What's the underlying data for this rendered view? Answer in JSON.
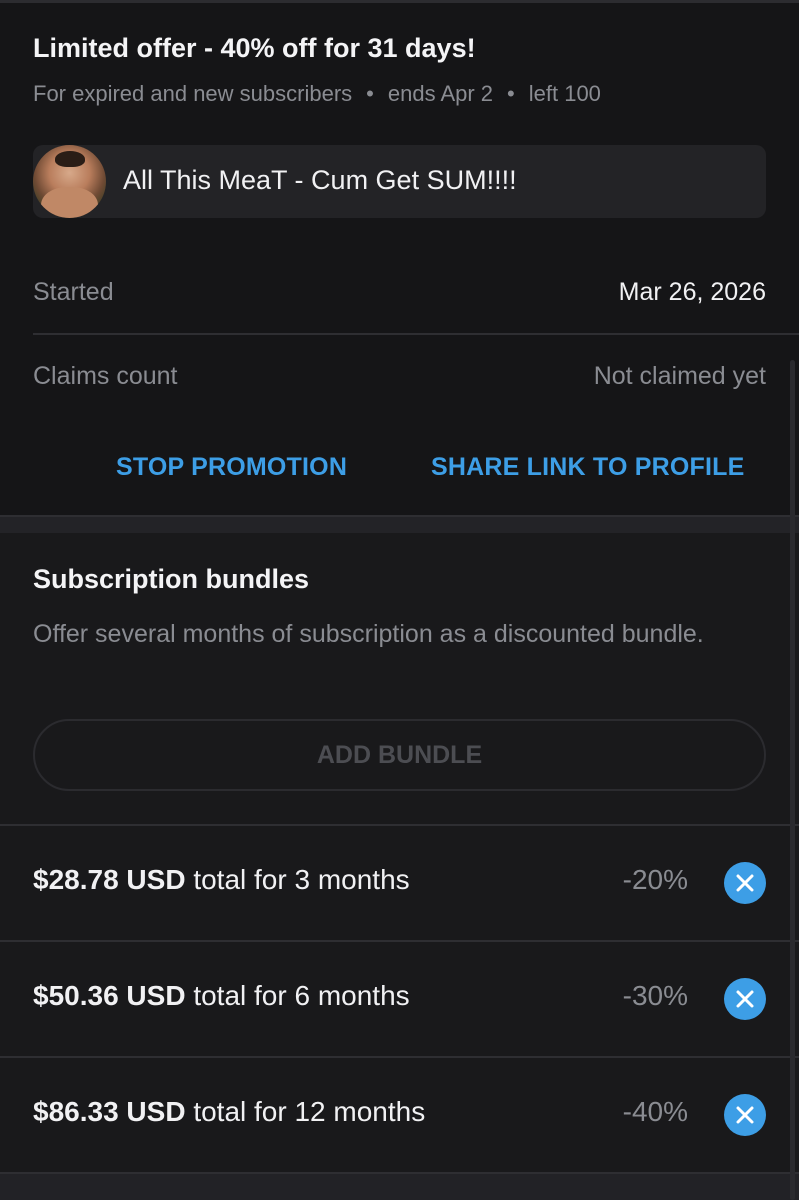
{
  "promotion": {
    "title": "Limited offer - 40% off for 31 days!",
    "audience": "For expired and new subscribers",
    "ends": "ends Apr 2",
    "left": "left 100",
    "separator": "•",
    "message": "All This MeaT - Cum Get SUM!!!!",
    "started_label": "Started",
    "started_value": "Mar 26, 2026",
    "claims_label": "Claims count",
    "claims_value": "Not claimed yet",
    "stop_button": "STOP PROMOTION",
    "share_button": "SHARE LINK TO PROFILE"
  },
  "bundles": {
    "title": "Subscription bundles",
    "description": "Offer several months of subscription as a discounted bundle.",
    "add_button": "ADD BUNDLE",
    "items": [
      {
        "price": "$28.78 USD",
        "period": " total for 3 months",
        "discount": "-20%"
      },
      {
        "price": "$50.36 USD",
        "period": " total for 6 months",
        "discount": "-30%"
      },
      {
        "price": "$86.33 USD",
        "period": " total for 12 months",
        "discount": "-40%"
      }
    ]
  },
  "colors": {
    "accent": "#3d9ee6",
    "background": "#19191b",
    "muted_text": "#8a8c92",
    "disabled_text": "#4c4d52"
  },
  "icons": {
    "remove": "close-icon",
    "avatar": "profile-avatar"
  }
}
